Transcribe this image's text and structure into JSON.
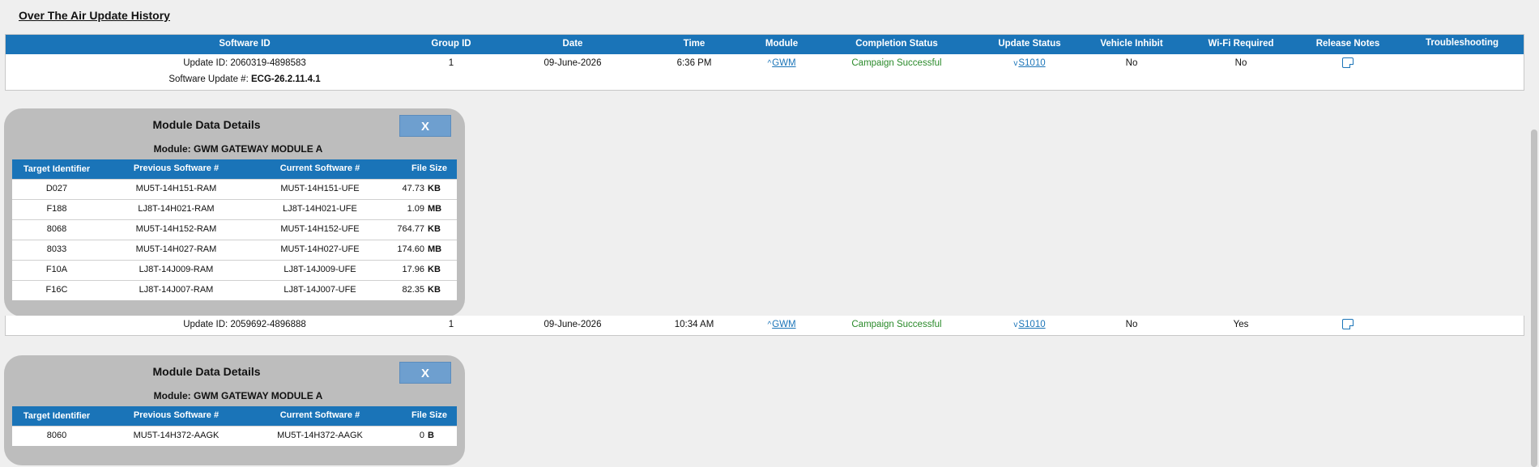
{
  "page_title": "Over The Air Update History",
  "columns": {
    "software_id": "Software ID",
    "group_id": "Group ID",
    "date": "Date",
    "time": "Time",
    "module": "Module",
    "completion_status": "Completion Status",
    "update_status": "Update Status",
    "vehicle_inhibit": "Vehicle Inhibit",
    "wifi_required": "Wi-Fi Required",
    "release_notes": "Release Notes",
    "troubleshooting": "Troubleshooting"
  },
  "updates": [
    {
      "update_id": "Update ID: 2060319-4898583",
      "software_update_label": "Software Update #:",
      "software_update_number": "ECG-26.2.11.4.1",
      "group_id": "1",
      "date": "09-June-2026",
      "time": "6:36 PM",
      "module_chevron": "^",
      "module": "GWM",
      "completion_status": "Campaign Successful",
      "update_chevron": "v",
      "update_status": "S1010",
      "vehicle_inhibit": "No",
      "wifi_required": "No",
      "release_notes_icon": "document-icon"
    },
    {
      "update_id": "Update ID: 2059692-4896888",
      "group_id": "1",
      "date": "09-June-2026",
      "time": "10:34 AM",
      "module_chevron": "^",
      "module": "GWM",
      "completion_status": "Campaign Successful",
      "update_chevron": "v",
      "update_status": "S1010",
      "vehicle_inhibit": "No",
      "wifi_required": "Yes",
      "release_notes_icon": "document-icon"
    }
  ],
  "module_details_1": {
    "title": "Module Data Details",
    "close_label": "X",
    "subtitle": "Module: GWM GATEWAY MODULE A",
    "headers": {
      "target": "Target Identifier",
      "previous": "Previous Software #",
      "current": "Current Software #",
      "file_size": "File Size"
    },
    "rows": [
      {
        "target": "D027",
        "previous": "MU5T-14H151-RAM",
        "current": "MU5T-14H151-UFE",
        "size": "47.73",
        "unit": "KB"
      },
      {
        "target": "F188",
        "previous": "LJ8T-14H021-RAM",
        "current": "LJ8T-14H021-UFE",
        "size": "1.09",
        "unit": "MB"
      },
      {
        "target": "8068",
        "previous": "MU5T-14H152-RAM",
        "current": "MU5T-14H152-UFE",
        "size": "764.77",
        "unit": "KB"
      },
      {
        "target": "8033",
        "previous": "MU5T-14H027-RAM",
        "current": "MU5T-14H027-UFE",
        "size": "174.60",
        "unit": "MB"
      },
      {
        "target": "F10A",
        "previous": "LJ8T-14J009-RAM",
        "current": "LJ8T-14J009-UFE",
        "size": "17.96",
        "unit": "KB"
      },
      {
        "target": "F16C",
        "previous": "LJ8T-14J007-RAM",
        "current": "LJ8T-14J007-UFE",
        "size": "82.35",
        "unit": "KB"
      }
    ]
  },
  "module_details_2": {
    "title": "Module Data Details",
    "close_label": "X",
    "subtitle": "Module: GWM GATEWAY MODULE A",
    "headers": {
      "target": "Target Identifier",
      "previous": "Previous Software #",
      "current": "Current Software #",
      "file_size": "File Size"
    },
    "rows": [
      {
        "target": "8060",
        "previous": "MU5T-14H372-AAGK",
        "current": "MU5T-14H372-AAGK",
        "size": "0",
        "unit": "B"
      }
    ]
  }
}
